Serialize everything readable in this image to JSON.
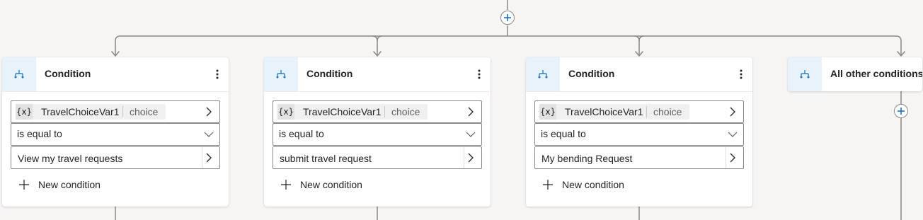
{
  "branches": [
    {
      "title": "Condition",
      "variable": {
        "icon_text": "{x}",
        "name": "TravelChoiceVar1",
        "type": "choice"
      },
      "operator": "is equal to",
      "value": "View my travel requests",
      "new_condition_label": "New condition"
    },
    {
      "title": "Condition",
      "variable": {
        "icon_text": "{x}",
        "name": "TravelChoiceVar1",
        "type": "choice"
      },
      "operator": "is equal to",
      "value": "submit travel request",
      "new_condition_label": "New condition"
    },
    {
      "title": "Condition",
      "variable": {
        "icon_text": "{x}",
        "name": "TravelChoiceVar1",
        "type": "choice"
      },
      "operator": "is equal to",
      "value": "My bending Request",
      "new_condition_label": "New condition"
    }
  ],
  "other_branch": {
    "title": "All other conditions"
  },
  "icons": {
    "add_node": "plus-icon",
    "branch": "branch-icon",
    "more": "more-vertical-icon",
    "chevron_right": "chevron-right-icon",
    "chevron_down": "chevron-down-icon"
  },
  "colors": {
    "accent": "#0f6cbd",
    "icon_box": "#e8f2fb",
    "connector": "#8a8886",
    "canvas": "#f6f5f4"
  }
}
